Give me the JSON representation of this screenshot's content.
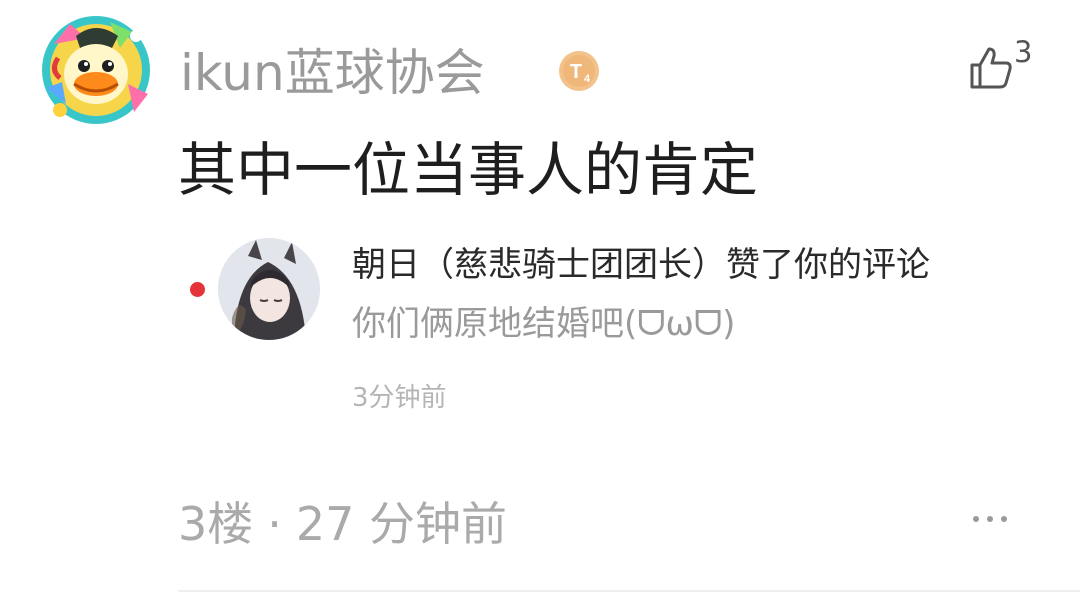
{
  "comment": {
    "username": "ikun蓝球协会",
    "level_badge": {
      "icon": "level-badge-icon",
      "text": "T",
      "subtext": "4",
      "color": "#f0b77a"
    },
    "like": {
      "icon": "thumb-up-icon",
      "count": "3"
    },
    "text": "其中一位当事人的肯定",
    "floor": "3楼",
    "separator": "·",
    "time": "27 分钟前",
    "more_icon": "more-dots-icon"
  },
  "notice": {
    "unread_color": "#e5333a",
    "title": "朝日（慈悲骑士团团长）赞了你的评论",
    "quote": "你们俩原地结婚吧(ᗜωᗜ)",
    "time": "3分钟前"
  }
}
